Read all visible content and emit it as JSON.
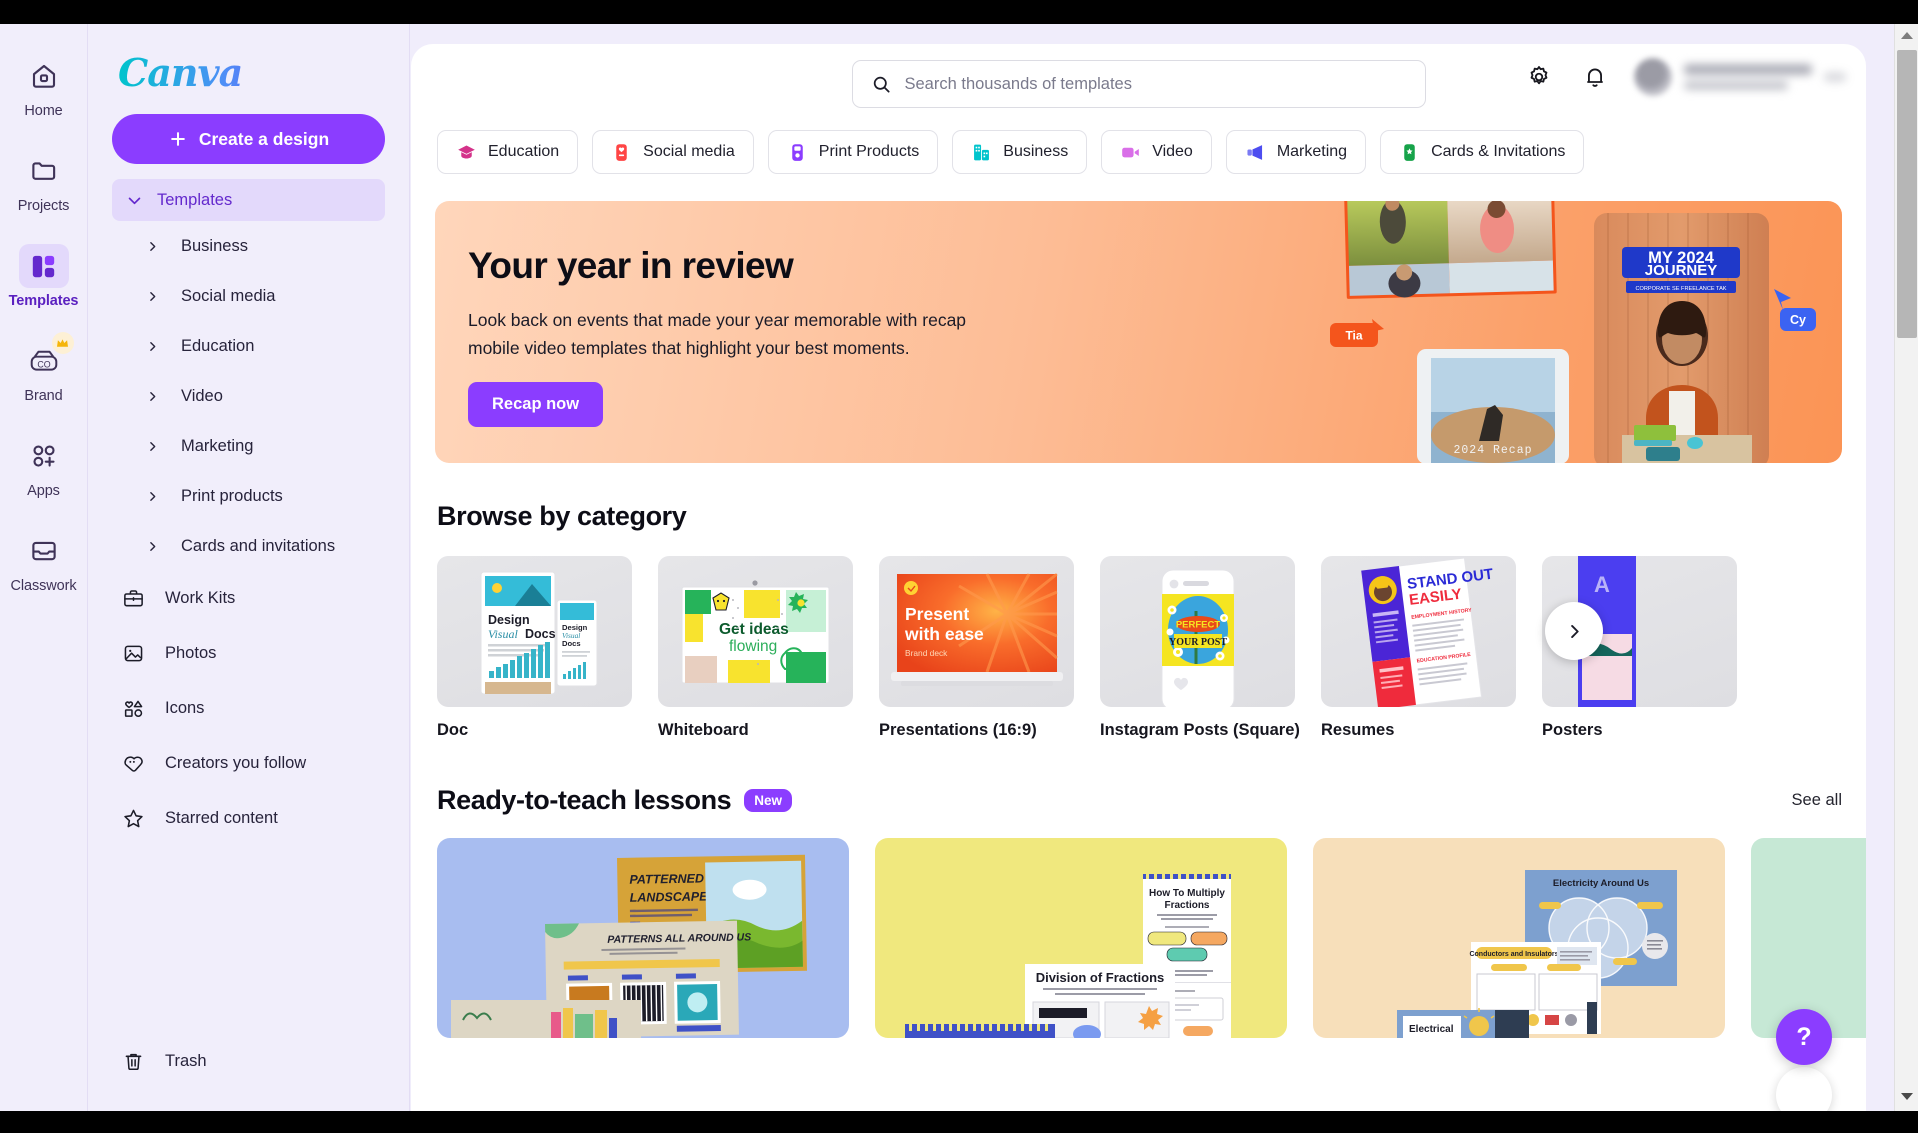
{
  "rail": {
    "items": [
      {
        "label": "Home",
        "icon": "home-icon",
        "active": false
      },
      {
        "label": "Projects",
        "icon": "folder-icon",
        "active": false
      },
      {
        "label": "Templates",
        "icon": "templates-grid-icon",
        "active": true
      },
      {
        "label": "Brand",
        "icon": "brand-co-icon",
        "active": false,
        "badge": "crown-icon"
      },
      {
        "label": "Apps",
        "icon": "apps-plus-icon",
        "active": false
      },
      {
        "label": "Classwork",
        "icon": "classwork-tray-icon",
        "active": false
      }
    ]
  },
  "sidebar": {
    "logo": "Canva",
    "create_button": "Create a design",
    "templates_section": "Templates",
    "template_subitems": [
      "Business",
      "Social media",
      "Education",
      "Video",
      "Marketing",
      "Print products",
      "Cards and invitations"
    ],
    "nav_items": [
      {
        "label": "Work Kits",
        "icon": "briefcase-icon"
      },
      {
        "label": "Photos",
        "icon": "photo-icon"
      },
      {
        "label": "Icons",
        "icon": "shapes-icon"
      },
      {
        "label": "Creators you follow",
        "icon": "heart-tag-icon"
      },
      {
        "label": "Starred content",
        "icon": "star-icon"
      }
    ],
    "trash": {
      "label": "Trash",
      "icon": "trash-icon"
    }
  },
  "topbar": {
    "search_placeholder": "Search thousands of templates",
    "search_value": "",
    "settings_icon": "gear-icon",
    "notifications_icon": "bell-icon",
    "profile_name": ""
  },
  "pills": [
    {
      "label": "Education",
      "icon": "graduation-cap-icon",
      "color": "#d4328a"
    },
    {
      "label": "Social media",
      "icon": "social-heart-icon",
      "color": "#ff4d4d"
    },
    {
      "label": "Print Products",
      "icon": "print-mug-icon",
      "color": "#8b3dff"
    },
    {
      "label": "Business",
      "icon": "building-icon",
      "color": "#00c4cc"
    },
    {
      "label": "Video",
      "icon": "video-camera-icon",
      "color": "#d96fe8"
    },
    {
      "label": "Marketing",
      "icon": "megaphone-icon",
      "color": "#4d4df0"
    },
    {
      "label": "Cards & Invitations",
      "icon": "card-star-icon",
      "color": "#17a34a"
    }
  ],
  "hero": {
    "title": "Your year in review",
    "subtitle": "Look back on events that made your year memorable with recap mobile video templates that highlight your best moments.",
    "button": "Recap now",
    "art": {
      "cursor_left": "Tia",
      "cursor_right": "Cy",
      "poster_line1": "MY 2024",
      "poster_line2": "JOURNEY",
      "poster_sub": "CORPORATE SE FREELANCE TAK",
      "video_caption": "2024  Recap"
    }
  },
  "browse": {
    "title": "Browse by category",
    "next_icon": "chevron-right-icon",
    "cards": [
      {
        "label": "Doc",
        "thumb": "doc-thumb",
        "t1": "Design",
        "t2": "Visual",
        "t3": "Docs"
      },
      {
        "label": "Whiteboard",
        "thumb": "whiteboard-thumb",
        "t1": "Get ideas",
        "t2": "flowing"
      },
      {
        "label": "Presentations (16:9)",
        "thumb": "presentation-thumb",
        "t1": "Present",
        "t2": "with ease",
        "t3": "Brand deck"
      },
      {
        "label": "Instagram Posts (Square)",
        "thumb": "instagram-thumb",
        "t1": "PERFECT",
        "t2": "YOUR POST"
      },
      {
        "label": "Resumes",
        "thumb": "resume-thumb",
        "t1": "STAND OUT",
        "t2": "EASILY"
      },
      {
        "label": "Posters",
        "thumb": "poster-thumb",
        "t1": "A"
      }
    ]
  },
  "lessons": {
    "title": "Ready-to-teach lessons",
    "badge": "New",
    "see_all": "See all",
    "cards": [
      {
        "bg": "#a8bdf0",
        "t1": "PATTERNED",
        "t2": "LANDSCAPE",
        "t3": "PATTERNS ALL AROUND US"
      },
      {
        "bg": "#f0e87e",
        "t1": "How To Multiply",
        "t2": "Fractions",
        "t3": "Division of Fractions"
      },
      {
        "bg": "#f7dfba",
        "t1": "Electricity Around Us",
        "t2": "Conductors and Insulators",
        "t3": "Electrical"
      },
      {
        "bg": "#c6e8d5",
        "t1": "",
        "t2": "",
        "t3": ""
      }
    ]
  },
  "help": {
    "label": "?",
    "icon": "question-mark-icon"
  },
  "scrollbar": {
    "up_icon": "triangle-up-icon",
    "down_icon": "triangle-down-icon"
  },
  "colors": {
    "brand_purple": "#8b3dff",
    "sidebar_bg": "#f1eefb",
    "active_purple": "#6429cd"
  }
}
